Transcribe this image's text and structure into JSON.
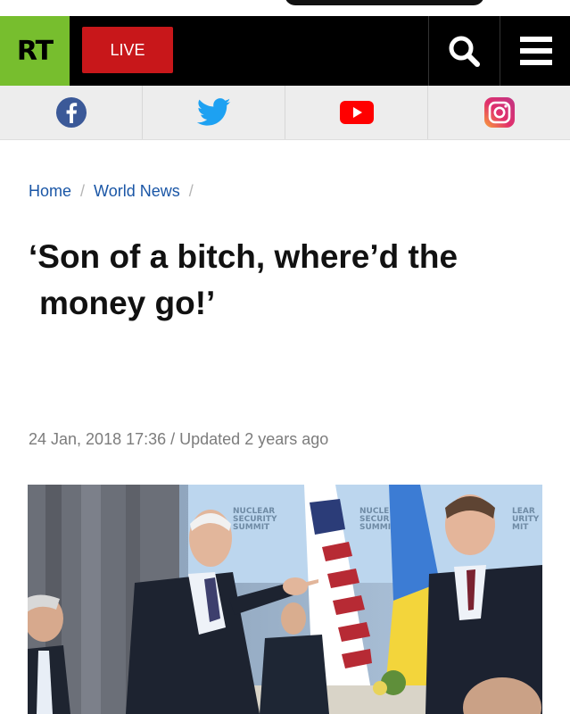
{
  "header": {
    "logo_text": "RT",
    "live_label": "LIVE",
    "brand_color": "#77be2e",
    "live_color": "#c8171a",
    "icons": [
      "search-icon",
      "menu-icon"
    ]
  },
  "social": {
    "items": [
      {
        "name": "facebook",
        "icon": "facebook-icon",
        "color": "#3b5998"
      },
      {
        "name": "twitter",
        "icon": "twitter-icon",
        "color": "#1da1f2"
      },
      {
        "name": "youtube",
        "icon": "youtube-icon",
        "color": "#ff0000"
      },
      {
        "name": "instagram",
        "icon": "instagram-icon",
        "color": "#e1306c"
      }
    ]
  },
  "breadcrumb": {
    "items": [
      "Home",
      "World News"
    ],
    "separator": "/"
  },
  "article": {
    "title_line1": "‘Son of a bitch, where’d the",
    "title_line2": "money go!’",
    "published": "24 Jan, 2018 17:36",
    "updated": " / Updated 2 years ago"
  },
  "photo": {
    "banner_text": [
      "NUCLEAR",
      "SECURITY",
      "SUMMIT"
    ],
    "banner_text_2": [
      "NUCLE",
      "SECUR",
      "SUMMI"
    ],
    "banner_text_3": [
      "LEAR",
      "URITY",
      "MIT"
    ]
  }
}
